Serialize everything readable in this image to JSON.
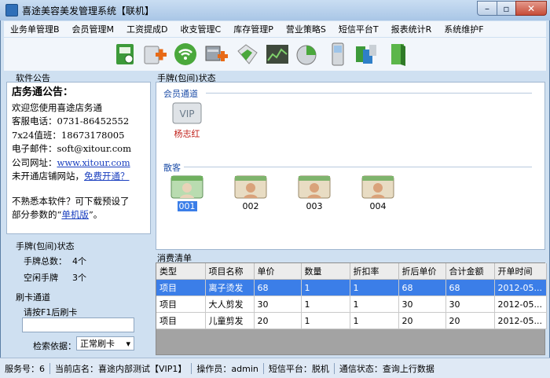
{
  "window": {
    "title": "喜途美容美发管理系统【联机】"
  },
  "menu": [
    {
      "label": "业务单管理B"
    },
    {
      "label": "会员管理M"
    },
    {
      "label": "工资提成D"
    },
    {
      "label": "收支管理C"
    },
    {
      "label": "库存管理P"
    },
    {
      "label": "营业策略S"
    },
    {
      "label": "短信平台T"
    },
    {
      "label": "报表统计R"
    },
    {
      "label": "系统维护F"
    }
  ],
  "toolbar_icons": [
    "book-icon",
    "add-member-icon",
    "wifi-icon",
    "add-product-icon",
    "tags-icon",
    "chart-icon",
    "pie-chart-icon",
    "phone-icon",
    "cubes-icon",
    "folder-icon"
  ],
  "notice": {
    "section_title": "软件公告",
    "heading": "店务通公告：",
    "line1": "欢迎您使用喜途店务通",
    "line2": "客服电话：0731-86452552",
    "line3": "7x24值班：18673178005",
    "line4": "电子邮件：soft@xitour.com",
    "line5_prefix": "公司网址：",
    "line5_link": "www.xitour.com",
    "line6_prefix": "未开通店铺网站，",
    "line6_link": "免费开通？",
    "line7": "不熟悉本软件？可下载预设了",
    "line8_prefix": "部分参数的“",
    "line8_link": "单机版",
    "line8_suffix": "”。"
  },
  "card_status": {
    "section_title": "手牌(包间)状态",
    "total_label": "手牌总数：",
    "total_value": "4个",
    "free_label": "空闲手牌",
    "free_value": "3个"
  },
  "swipe": {
    "section_title": "刷卡通道",
    "prompt": "请按F1后刷卡",
    "search_label": "检索依据：",
    "search_value": "正常刷卡"
  },
  "room_panel": {
    "title": "手牌(包间)状态",
    "member_group": "会员通道",
    "member_name": "杨志红",
    "guest_group": "散客",
    "guests": [
      "001",
      "002",
      "003",
      "004"
    ]
  },
  "consume": {
    "title": "消费清单",
    "columns": [
      "类型",
      "项目名称",
      "单价",
      "数量",
      "折扣率",
      "折后单价",
      "合计金额",
      "开单时间"
    ],
    "rows": [
      [
        "项目",
        "离子烫发",
        "68",
        "1",
        "1",
        "68",
        "68",
        "2012-05..."
      ],
      [
        "项目",
        "大人剪发",
        "30",
        "1",
        "1",
        "30",
        "30",
        "2012-05..."
      ],
      [
        "项目",
        "儿童剪发",
        "20",
        "1",
        "1",
        "20",
        "20",
        "2012-05..."
      ]
    ]
  },
  "status": {
    "service": "服务号：6",
    "shop": "当前店名：喜途内部测试【VIP1】",
    "operator": "操作员：admin",
    "sms": "短信平台：脱机",
    "comm": "通信状态：查询上行数据"
  },
  "colors": {
    "accent": "#3b7ee8",
    "link": "#1a3fbf",
    "group": "#1f4fa8",
    "window_bg": "#cfe0f1"
  }
}
